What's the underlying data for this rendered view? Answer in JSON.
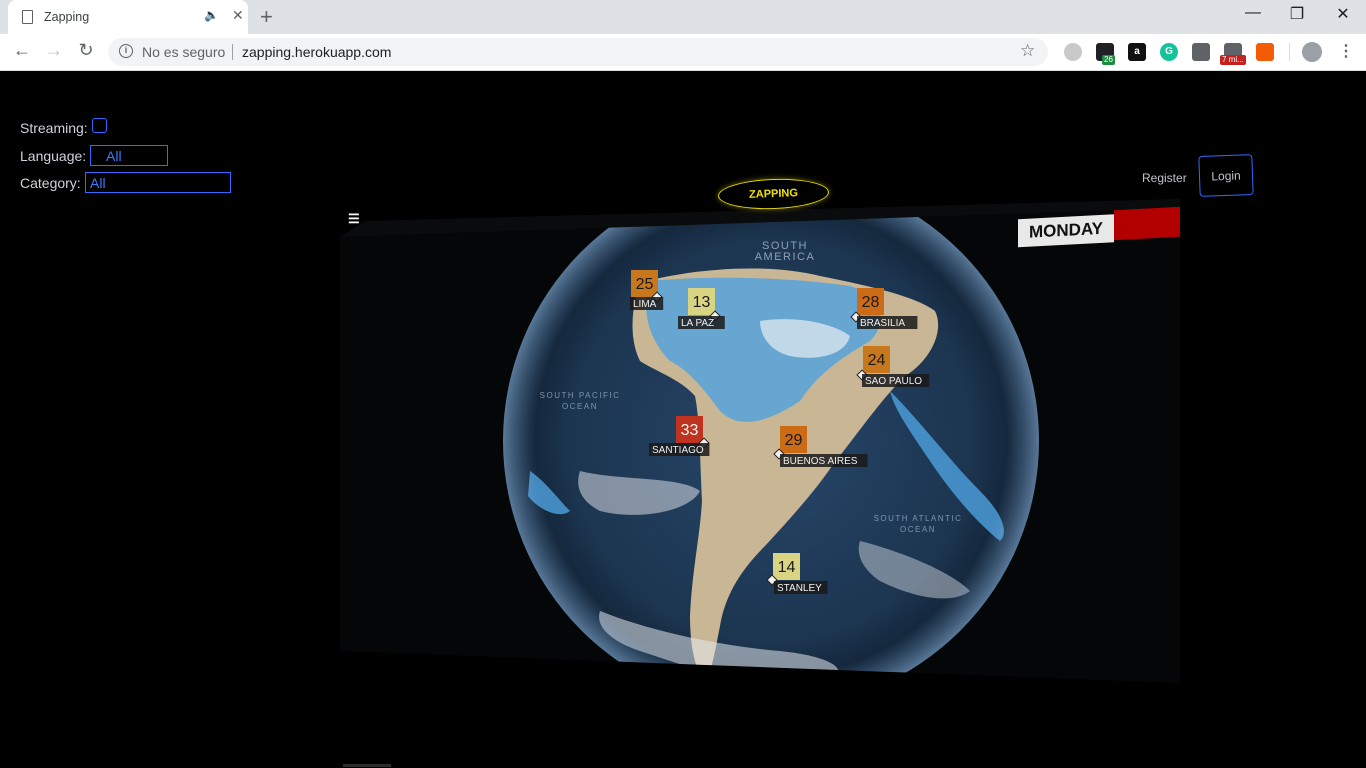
{
  "browser": {
    "tab_title": "Zapping",
    "tab_close": "✕",
    "tab_audio": "🔈",
    "new_tab": "+",
    "window_minimize": "—",
    "window_restore": "❐",
    "window_close": "✕",
    "security_label": "No es seguro",
    "url": "zapping.herokuapp.com",
    "extensions": [
      {
        "name": "extension-1",
        "color": "#c9c9c9"
      },
      {
        "name": "extension-2",
        "color": "#202124",
        "badge": "26",
        "badge_color": "#1e8e3e"
      },
      {
        "name": "amazon-extension",
        "color": "#111111",
        "text": "a"
      },
      {
        "name": "grammarly-extension",
        "color": "#15c39a",
        "text": "G"
      },
      {
        "name": "extension-bulb",
        "color": "#5f6368"
      },
      {
        "name": "extension-7min",
        "color": "#5f6368",
        "badge": "7 mi...",
        "badge_color": "#c5221f"
      },
      {
        "name": "lock-extension",
        "color": "#f25c05"
      }
    ]
  },
  "filters": {
    "streaming_label": "Streaming:",
    "language_label": "Language:",
    "language_value": "All",
    "category_label": "Category:",
    "category_value": "All"
  },
  "nav": {
    "register": "Register",
    "login": "Login"
  },
  "zapping_button": "ZAPPING",
  "menu_icon": "☰",
  "day_banner": "MONDAY",
  "map": {
    "region_labels": [
      {
        "text": "SOUTH AMERICA",
        "lon": -60,
        "lat": 8
      },
      {
        "text": "SOUTH PACIFIC OCEAN",
        "lon": -103,
        "lat": -20
      },
      {
        "text": "SOUTH ATLANTIC OCEAN",
        "lon": -18,
        "lat": -40
      }
    ],
    "cities": [
      {
        "name": "LIMA",
        "temp": "25",
        "color": "#c8781c"
      },
      {
        "name": "LA PAZ",
        "temp": "13",
        "color": "#d9d482"
      },
      {
        "name": "BRASILIA",
        "temp": "28",
        "color": "#cc6a16"
      },
      {
        "name": "SAO PAULO",
        "temp": "24",
        "color": "#c8781c"
      },
      {
        "name": "SANTIAGO",
        "temp": "33",
        "color": "#c0341f"
      },
      {
        "name": "BUENOS AIRES",
        "temp": "29",
        "color": "#cc6a16"
      },
      {
        "name": "STANLEY",
        "temp": "14",
        "color": "#d9d482"
      }
    ]
  }
}
